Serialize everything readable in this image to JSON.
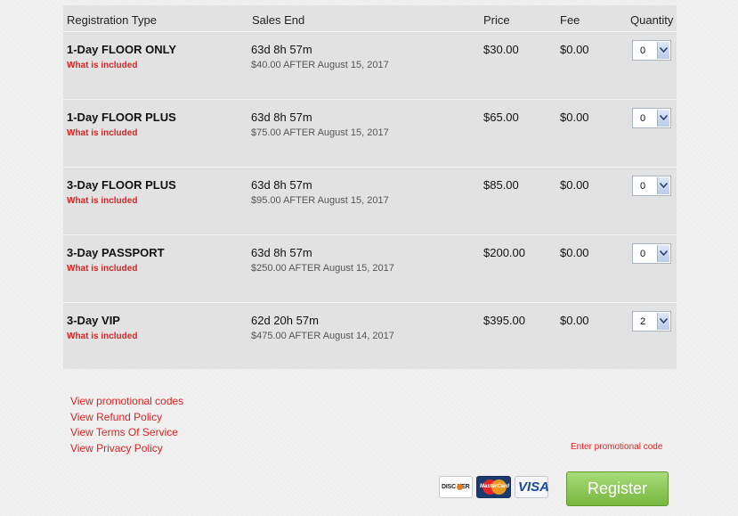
{
  "headers": {
    "type": "Registration Type",
    "sales_end": "Sales End",
    "price": "Price",
    "fee": "Fee",
    "quantity": "Quantity"
  },
  "rows": [
    {
      "name": "1-Day FLOOR ONLY",
      "included": "What is included",
      "ends": "63d 8h 57m",
      "after": "$40.00 AFTER August 15, 2017",
      "price": "$30.00",
      "fee": "$0.00",
      "qty": "0"
    },
    {
      "name": "1-Day FLOOR PLUS",
      "included": "What is included",
      "ends": "63d 8h 57m",
      "after": "$75.00 AFTER August 15, 2017",
      "price": "$65.00",
      "fee": "$0.00",
      "qty": "0"
    },
    {
      "name": "3-Day FLOOR PLUS",
      "included": "What is included",
      "ends": "63d 8h 57m",
      "after": "$95.00 AFTER August 15, 2017",
      "price": "$85.00",
      "fee": "$0.00",
      "qty": "0"
    },
    {
      "name": "3-Day PASSPORT",
      "included": "What is included",
      "ends": "63d 8h 57m",
      "after": "$250.00 AFTER August 15, 2017",
      "price": "$200.00",
      "fee": "$0.00",
      "qty": "0"
    },
    {
      "name": "3-Day VIP",
      "included": "What is included",
      "ends": "62d 20h 57m",
      "after": "$475.00 AFTER August 14, 2017",
      "price": "$395.00",
      "fee": "$0.00",
      "qty": "2"
    }
  ],
  "links": {
    "promo_codes": "View promotional codes",
    "refund": "View Refund Policy",
    "terms": "View Terms Of Service",
    "privacy": "View Privacy Policy"
  },
  "enter_promo": "Enter promotional code",
  "cards": {
    "discover": "DISC VER",
    "mastercard": "MasterCard",
    "visa": "VISA"
  },
  "icons": {
    "quantity_arrow": "chevron-down-icon"
  },
  "register_label": "Register",
  "colors": {
    "link_red": "#e02020",
    "register_green": "#76b63e",
    "table_bg": "#e2e2e2"
  }
}
